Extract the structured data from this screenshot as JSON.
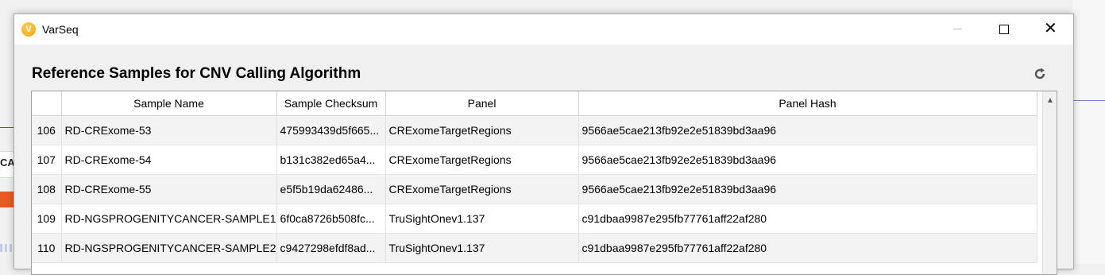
{
  "background": {
    "fragment_text": "CA"
  },
  "window": {
    "title": "VarSeq",
    "minimize_glyph": "—",
    "close_glyph": "✕"
  },
  "heading": "Reference Samples for CNV Calling Algorithm",
  "table": {
    "columns": [
      "Sample Name",
      "Sample Checksum",
      "Panel",
      "Panel Hash"
    ],
    "rows": [
      {
        "index": "106",
        "sample_name": "RD-CRExome-53",
        "checksum": "475993439d5f665...",
        "panel": "CRExomeTargetRegions",
        "hash": "9566ae5cae213fb92e2e51839bd3aa96"
      },
      {
        "index": "107",
        "sample_name": "RD-CRExome-54",
        "checksum": "b131c382ed65a4...",
        "panel": "CRExomeTargetRegions",
        "hash": "9566ae5cae213fb92e2e51839bd3aa96"
      },
      {
        "index": "108",
        "sample_name": "RD-CRExome-55",
        "checksum": "e5f5b19da62486...",
        "panel": "CRExomeTargetRegions",
        "hash": "9566ae5cae213fb92e2e51839bd3aa96"
      },
      {
        "index": "109",
        "sample_name": "RD-NGSPROGENITYCANCER-SAMPLE1",
        "checksum": "6f0ca8726b508fc...",
        "panel": "TruSightOnev1.137",
        "hash": "c91dbaa9987e295fb77761aff22af280"
      },
      {
        "index": "110",
        "sample_name": "RD-NGSPROGENITYCANCER-SAMPLE2",
        "checksum": "c9427298efdf8ad...",
        "panel": "TruSightOnev1.137",
        "hash": "c91dbaa9987e295fb77761aff22af280"
      }
    ]
  },
  "icons": {
    "app": "varseq-logo-icon",
    "refresh": "refresh-icon",
    "scroll_up": "chevron-up-icon"
  }
}
